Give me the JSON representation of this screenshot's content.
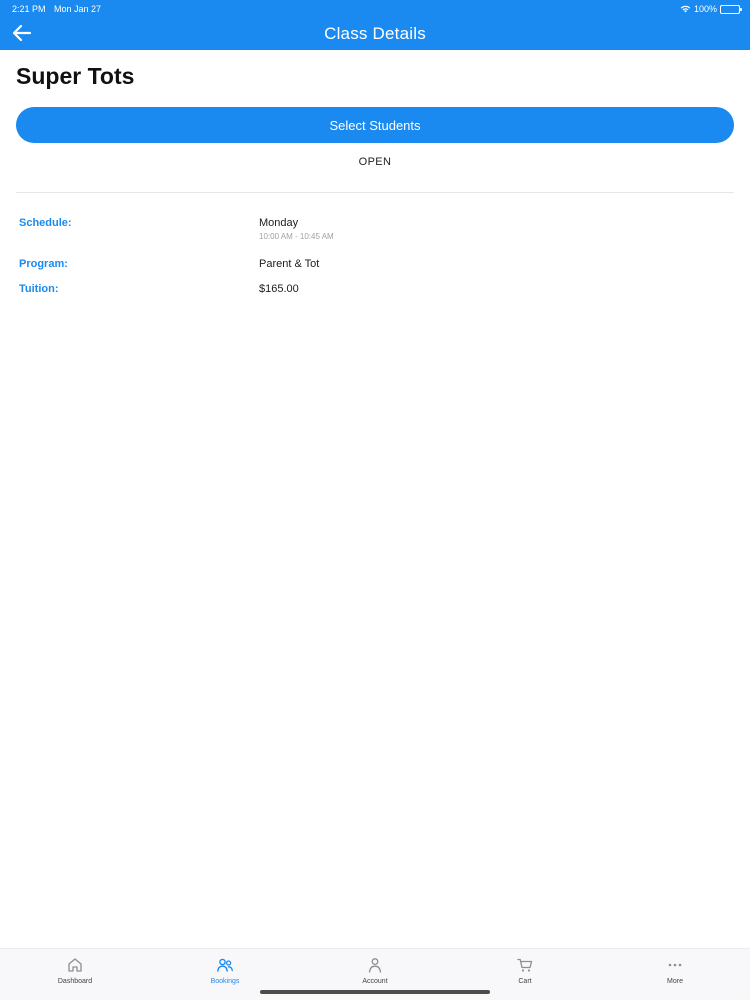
{
  "status_bar": {
    "time": "2:21 PM",
    "date": "Mon Jan 27",
    "battery": "100%"
  },
  "nav": {
    "title": "Class Details",
    "back_icon": "arrow-left-icon"
  },
  "class": {
    "name": "Super Tots",
    "select_button_label": "Select Students",
    "status": "OPEN"
  },
  "details": {
    "schedule_label": "Schedule:",
    "schedule_day": "Monday",
    "schedule_time": "10:00 AM - 10:45 AM",
    "program_label": "Program:",
    "program_value": "Parent & Tot",
    "tuition_label": "Tuition:",
    "tuition_value": "$165.00"
  },
  "tabbar": {
    "items": [
      {
        "label": "Dashboard",
        "icon": "home-icon"
      },
      {
        "label": "Bookings",
        "icon": "people-icon",
        "active": true
      },
      {
        "label": "Account",
        "icon": "person-icon"
      },
      {
        "label": "Cart",
        "icon": "cart-icon"
      },
      {
        "label": "More",
        "icon": "more-icon"
      }
    ]
  },
  "colors": {
    "accent": "#1a8af0",
    "inactive_icon": "#8e8e93"
  }
}
